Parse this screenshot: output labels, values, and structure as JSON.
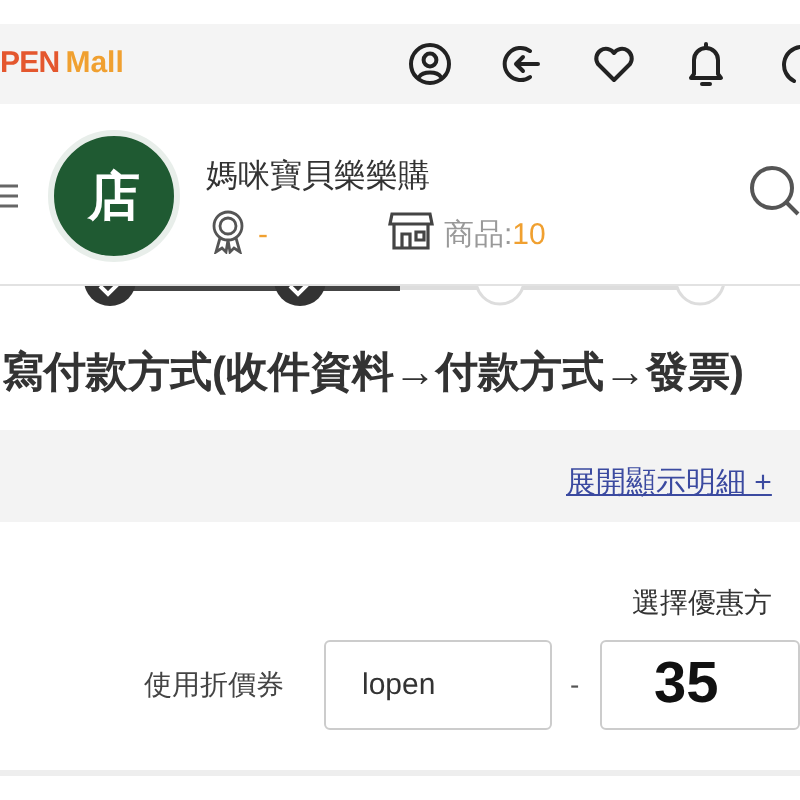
{
  "header": {
    "logo": {
      "open": "PEN",
      "mall": "Mall"
    }
  },
  "shop": {
    "avatar": "店",
    "name": "媽咪寶貝樂樂購",
    "rating": "-",
    "products_label": "商品:",
    "products_count": "10"
  },
  "steps": [
    {
      "done": true
    },
    {
      "done": true
    },
    {
      "done": false
    },
    {
      "done": false
    }
  ],
  "title": "寫付款方式(收件資料→付款方式→發票)",
  "details_link": "展開顯示明細 +",
  "discount": {
    "heading": "選擇優惠方",
    "coupon_label": "使用折價券",
    "coupon_value": "lopen",
    "separator": "-",
    "amount": "35"
  }
}
